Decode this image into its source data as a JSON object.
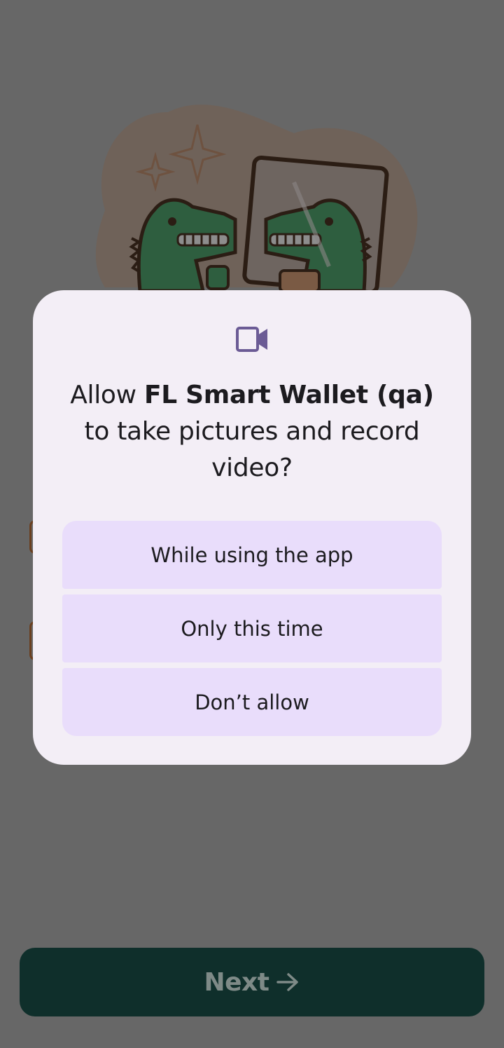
{
  "dialog": {
    "icon": "videocam-icon",
    "title_prefix": "Allow ",
    "app_name": "FL Smart Wallet (qa)",
    "title_suffix": " to take pictures and record video?",
    "options": [
      {
        "label": "While using the app"
      },
      {
        "label": "Only this time"
      },
      {
        "label": "Don’t allow"
      }
    ]
  },
  "footer": {
    "next_label": "Next",
    "next_icon": "arrow-right-icon"
  },
  "background": {
    "illustration": "crocodile-selfie-illustration"
  },
  "colors": {
    "scrim": "#676767",
    "dialog_bg": "#f3eef6",
    "option_bg": "#e9ddfb",
    "icon_accent": "#6b5b95",
    "next_button_bg": "#0f2f2b",
    "next_text": "#7e8a87"
  }
}
